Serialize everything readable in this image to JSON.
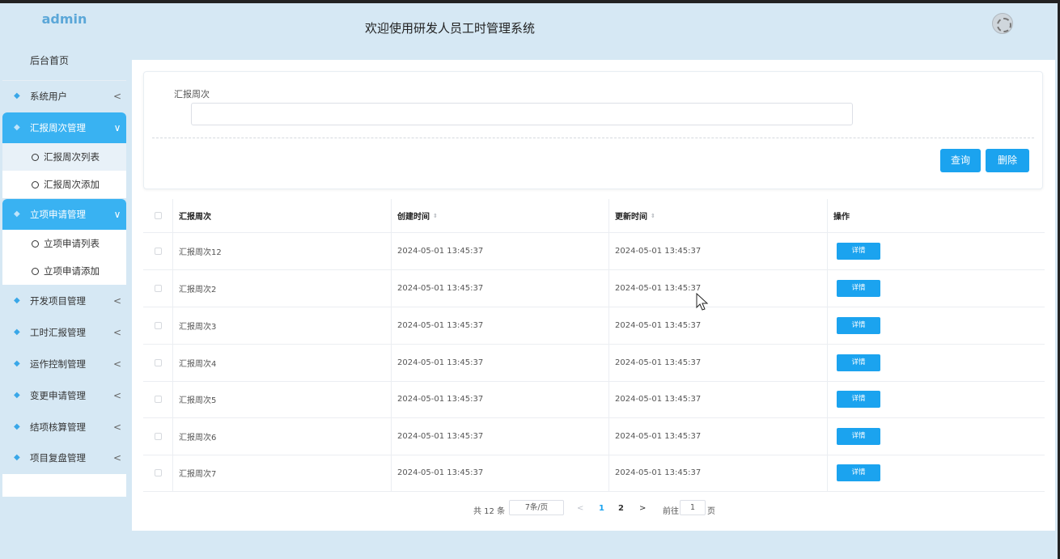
{
  "brand": "admin",
  "header": {
    "title": "欢迎使用研发人员工时管理系统"
  },
  "sidebar": {
    "home": "后台首页",
    "menus": [
      {
        "label": "系统用户",
        "chev": "<"
      },
      {
        "label": "汇报周次管理",
        "chev": "∨"
      },
      {
        "label": "立项申请管理",
        "chev": "∨"
      },
      {
        "label": "开发项目管理",
        "chev": "<"
      },
      {
        "label": "工时汇报管理",
        "chev": "<"
      },
      {
        "label": "运作控制管理",
        "chev": "<"
      },
      {
        "label": "变更申请管理",
        "chev": "<"
      },
      {
        "label": "结项核算管理",
        "chev": "<"
      },
      {
        "label": "项目复盘管理",
        "chev": "<"
      }
    ],
    "subs": [
      {
        "label": "汇报周次列表"
      },
      {
        "label": "汇报周次添加"
      },
      {
        "label": "立项申请列表"
      },
      {
        "label": "立项申请添加"
      }
    ]
  },
  "search": {
    "label": "汇报周次",
    "value": "",
    "query_btn": "查询",
    "delete_btn": "删除"
  },
  "table": {
    "headers": [
      "汇报周次",
      "创建时间",
      "更新时间",
      "操作"
    ],
    "sort_glyph": "⇕",
    "rows": [
      {
        "name": "汇报周次12",
        "created": "2024-05-01 13:45:37",
        "updated": "2024-05-01 13:45:37",
        "action": "详情"
      },
      {
        "name": "汇报周次2",
        "created": "2024-05-01 13:45:37",
        "updated": "2024-05-01 13:45:37",
        "action": "详情"
      },
      {
        "name": "汇报周次3",
        "created": "2024-05-01 13:45:37",
        "updated": "2024-05-01 13:45:37",
        "action": "详情"
      },
      {
        "name": "汇报周次4",
        "created": "2024-05-01 13:45:37",
        "updated": "2024-05-01 13:45:37",
        "action": "详情"
      },
      {
        "name": "汇报周次5",
        "created": "2024-05-01 13:45:37",
        "updated": "2024-05-01 13:45:37",
        "action": "详情"
      },
      {
        "name": "汇报周次6",
        "created": "2024-05-01 13:45:37",
        "updated": "2024-05-01 13:45:37",
        "action": "详情"
      },
      {
        "name": "汇报周次7",
        "created": "2024-05-01 13:45:37",
        "updated": "2024-05-01 13:45:37",
        "action": "详情"
      }
    ]
  },
  "pager": {
    "total": "共 12 条",
    "page_size": "7条/页",
    "prev": "<",
    "page1": "1",
    "page2": "2",
    "next": ">",
    "goto": "前往",
    "jump_value": "1",
    "page_suffix": "页"
  },
  "colors": {
    "accent": "#1ba3ef",
    "sidebar_active": "#39b2f2",
    "background": "#d6e8f4"
  }
}
